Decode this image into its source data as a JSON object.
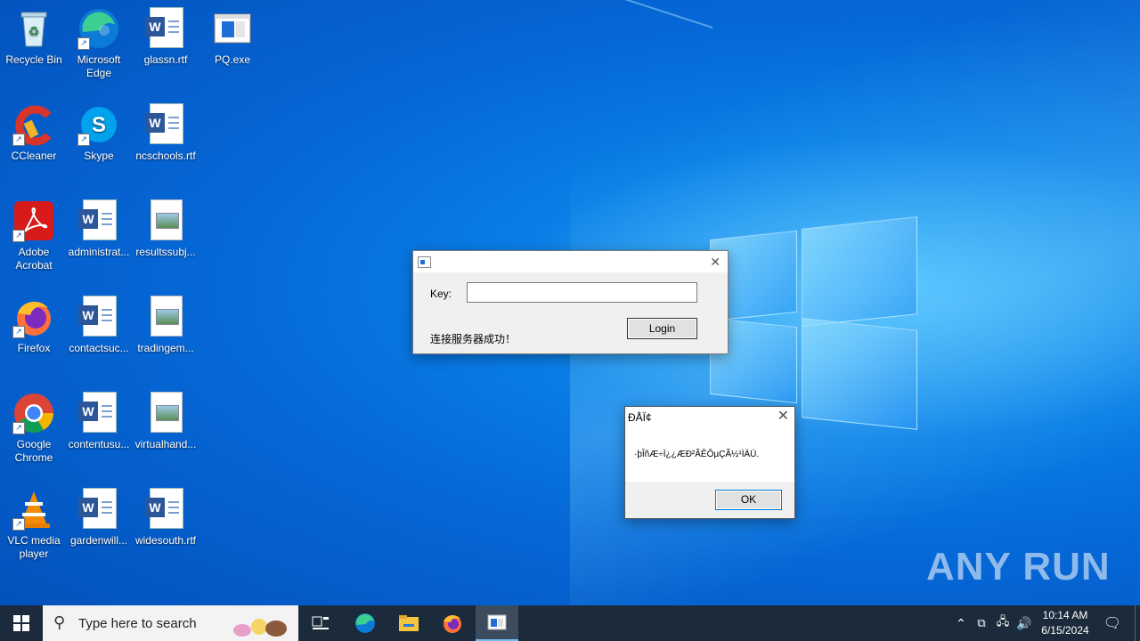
{
  "desktop_icons": [
    {
      "label": "Recycle Bin",
      "icon": "recycle-bin-icon"
    },
    {
      "label": "Microsoft Edge",
      "icon": "edge-icon"
    },
    {
      "label": "glassn.rtf",
      "icon": "word-doc-icon"
    },
    {
      "label": "PQ.exe",
      "icon": "app-window-icon"
    },
    {
      "label": "CCleaner",
      "icon": "ccleaner-icon"
    },
    {
      "label": "Skype",
      "icon": "skype-icon"
    },
    {
      "label": "ncschools.rtf",
      "icon": "word-doc-icon"
    },
    {
      "label": "Adobe Acrobat",
      "icon": "acrobat-icon"
    },
    {
      "label": "administrat...",
      "icon": "word-doc-icon"
    },
    {
      "label": "resultssubj...",
      "icon": "image-doc-icon"
    },
    {
      "label": "Firefox",
      "icon": "firefox-icon"
    },
    {
      "label": "contactsuc...",
      "icon": "word-doc-icon"
    },
    {
      "label": "tradingem...",
      "icon": "image-doc-icon"
    },
    {
      "label": "Google Chrome",
      "icon": "chrome-icon"
    },
    {
      "label": "contentusu...",
      "icon": "word-doc-icon"
    },
    {
      "label": "virtualhand...",
      "icon": "image-doc-icon"
    },
    {
      "label": "VLC media player",
      "icon": "vlc-icon"
    },
    {
      "label": "gardenwill...",
      "icon": "word-doc-icon"
    },
    {
      "label": "widesouth.rtf",
      "icon": "word-doc-icon"
    }
  ],
  "login_dialog": {
    "title": "",
    "key_label": "Key:",
    "key_value": "",
    "login_button": "Login",
    "status_text": "连接服务器成功！",
    "close_glyph": "✕"
  },
  "message_box": {
    "title": "ÐÅÏ¢",
    "message": "·þÎñÆ÷Ï¿¿ÆÐ²ÃÊÔµÇÃ½¹ÌÄÜ.",
    "ok_button": "OK",
    "close_glyph": "✕"
  },
  "taskbar": {
    "search_placeholder": "Type here to search",
    "time": "10:14 AM",
    "date": "6/15/2024"
  },
  "watermark": "ANY RUN",
  "colors": {
    "desktop_blue": "#0567d6",
    "taskbar": "#1b2b3b",
    "dialog_bg": "#f0f0f0"
  }
}
